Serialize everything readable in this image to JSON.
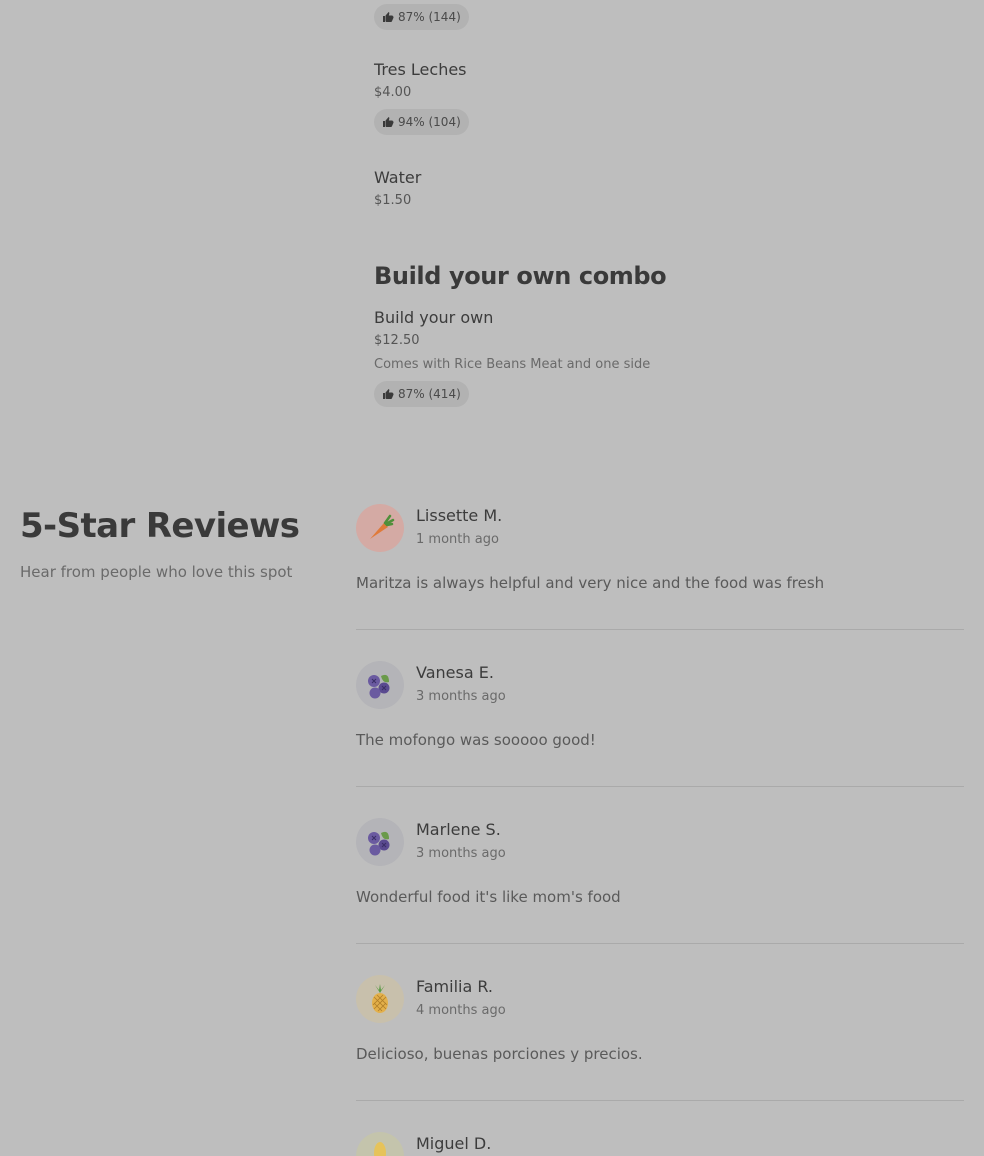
{
  "menu": {
    "top_item": {
      "rating": "87% (144)"
    },
    "items": [
      {
        "name": "Tres Leches",
        "price": "$4.00",
        "rating": "94% (104)"
      },
      {
        "name": "Water",
        "price": "$1.50"
      }
    ],
    "combo_section": {
      "title": "Build your own combo",
      "item": {
        "name": "Build your own",
        "price": "$12.50",
        "description": "Comes with Rice Beans Meat and one side",
        "rating": "87% (414)"
      }
    }
  },
  "reviews_section": {
    "title": "5-Star Reviews",
    "subtitle": "Hear from people who love this spot",
    "reviews": [
      {
        "name": "Lissette M.",
        "date": "1 month ago",
        "text": "Maritza is always helpful and very nice and the food was fresh",
        "avatar_icon": "carrot-icon"
      },
      {
        "name": "Vanesa E.",
        "date": "3 months ago",
        "text": "The mofongo was sooooo good!",
        "avatar_icon": "blueberry-icon"
      },
      {
        "name": "Marlene S.",
        "date": "3 months ago",
        "text": "Wonderful food it's like mom's food",
        "avatar_icon": "blueberry-icon"
      },
      {
        "name": "Familia R.",
        "date": "4 months ago",
        "text": "Delicioso, buenas porciones y precios.",
        "avatar_icon": "pineapple-icon"
      },
      {
        "name": "Miguel D.",
        "date": "",
        "text": "",
        "avatar_icon": "corn-icon"
      }
    ]
  },
  "colors": {
    "background": "#bebebe",
    "pill": "#b2b2b2",
    "carrot_bg": "#d4aaa4",
    "blueberry_bg": "#b4b4b8",
    "pineapple_bg": "#c8c0ac",
    "corn_bg": "#c4c4ac"
  }
}
